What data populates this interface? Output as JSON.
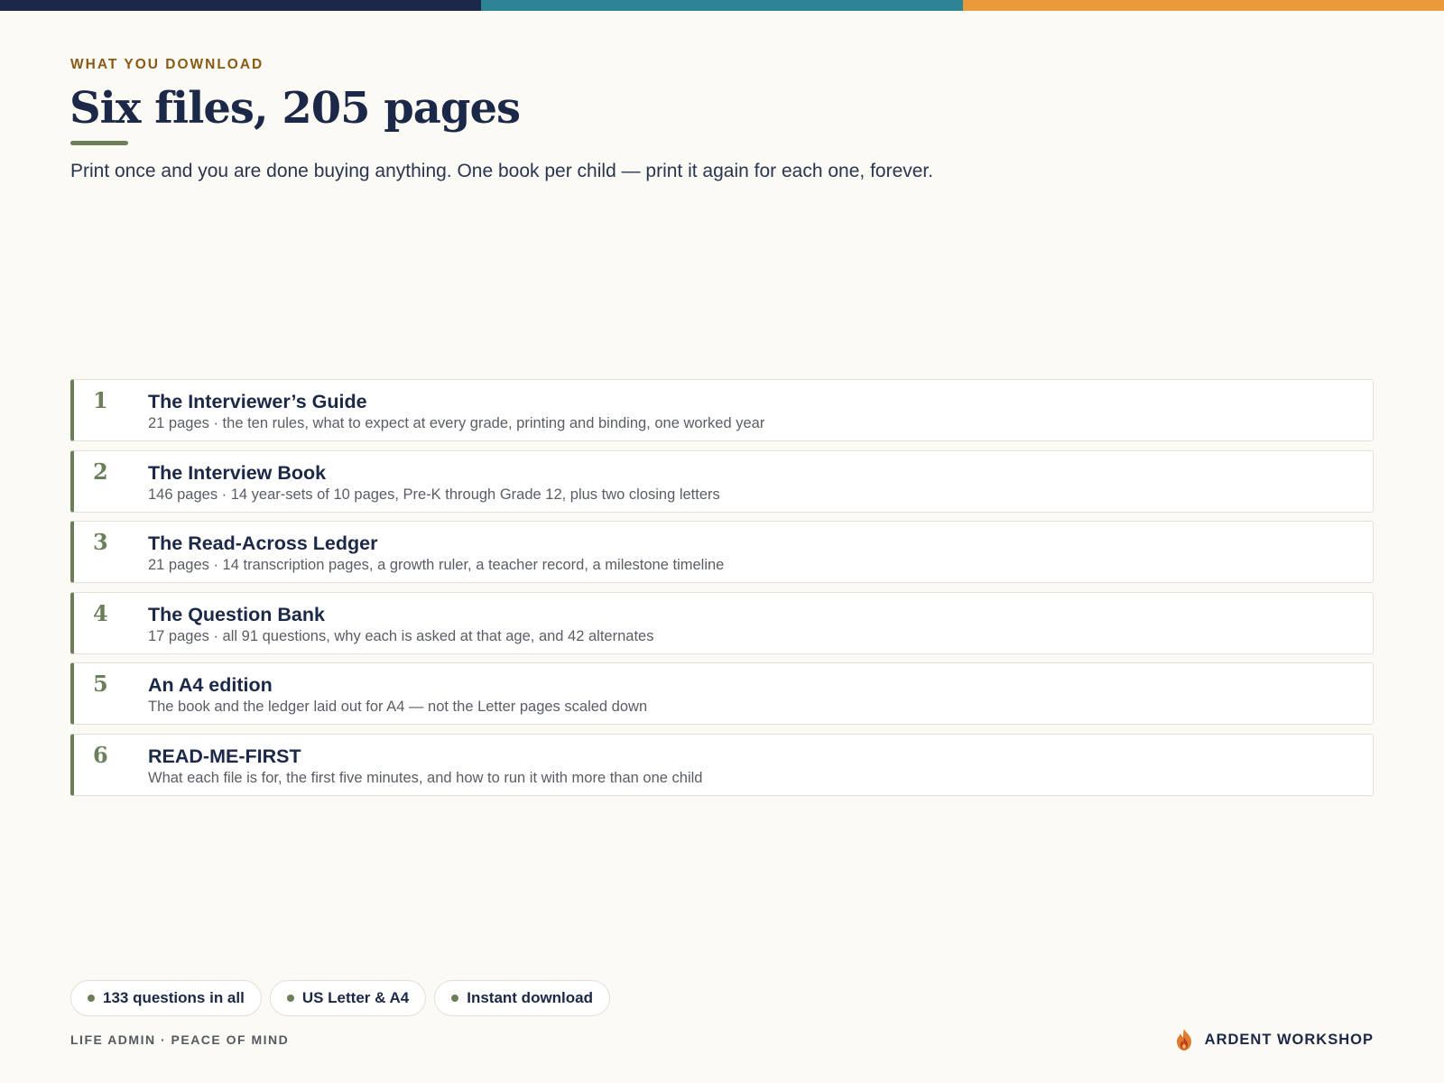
{
  "header": {
    "eyebrow": "WHAT YOU DOWNLOAD",
    "title": "Six files, 205 pages",
    "subtitle": "Print once and you are done buying anything. One book per child — print it again for each one, forever."
  },
  "files": [
    {
      "number": "1",
      "title": "The Interviewer’s Guide",
      "description": "21 pages · the ten rules, what to expect at every grade, printing and binding, one worked year"
    },
    {
      "number": "2",
      "title": "The Interview Book",
      "description": "146 pages · 14 year-sets of 10 pages, Pre-K through Grade 12, plus two closing letters"
    },
    {
      "number": "3",
      "title": "The Read-Across Ledger",
      "description": "21 pages · 14 transcription pages, a growth ruler, a teacher record, a milestone timeline"
    },
    {
      "number": "4",
      "title": "The Question Bank",
      "description": "17 pages · all 91 questions, why each is asked at that age, and 42 alternates"
    },
    {
      "number": "5",
      "title": "An A4 edition",
      "description": "The book and the ledger laid out for A4 — not the Letter pages scaled down"
    },
    {
      "number": "6",
      "title": "READ-ME-FIRST",
      "description": "What each file is for, the first five minutes, and how to run it with more than one child"
    }
  ],
  "chips": [
    {
      "label": "133 questions in all"
    },
    {
      "label": "US Letter & A4"
    },
    {
      "label": "Instant download"
    }
  ],
  "footer": {
    "tagline": "LIFE ADMIN · PEACE OF MIND",
    "brand": "ARDENT WORKSHOP",
    "logo_icon": "flame-icon"
  },
  "colors": {
    "navy": "#1c2847",
    "teal": "#2e8493",
    "orange": "#e89a3c",
    "sage": "#6b7f5a",
    "eyebrow_brown": "#8a5a14",
    "background": "#fbfaf5"
  }
}
